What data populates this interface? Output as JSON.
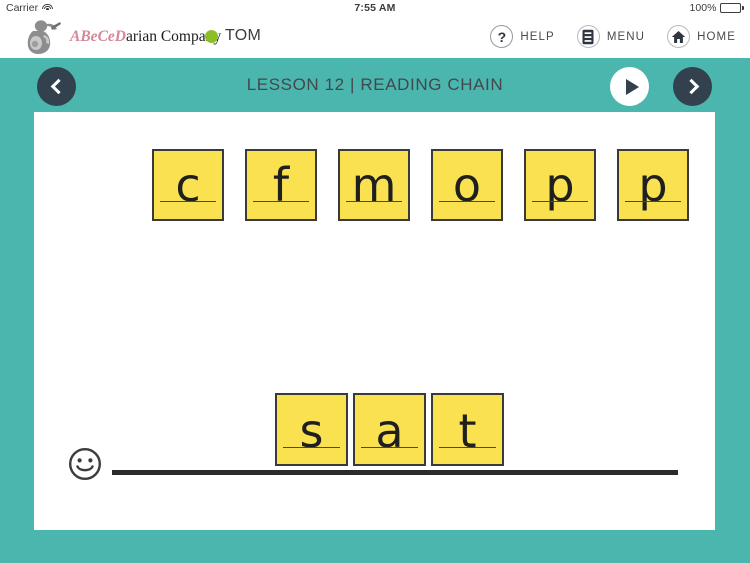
{
  "status_bar": {
    "carrier": "Carrier",
    "wifi_icon": "wifi-icon",
    "time": "7:55 AM",
    "battery_percent": "100%",
    "battery_icon": "battery-full-icon"
  },
  "header": {
    "logo_icon": "abecedarian-logo-icon",
    "brand_a": "A",
    "brand_b": "Be",
    "brand_c": "Ce",
    "brand_d": "D",
    "brand_rest": "arian Company",
    "user_status_icon": "status-dot-icon",
    "user_name": "TOM",
    "actions": [
      {
        "label": "HELP",
        "icon": "question-mark-icon"
      },
      {
        "label": "MENU",
        "icon": "menu-list-icon"
      },
      {
        "label": "HOME",
        "icon": "home-icon"
      }
    ]
  },
  "lesson": {
    "title": "LESSON 12 | READING CHAIN",
    "prev_icon": "chevron-left-icon",
    "play_icon": "play-icon",
    "next_icon": "chevron-right-icon"
  },
  "activity": {
    "top_row_tiles": [
      "c",
      "f",
      "m",
      "o",
      "p",
      "p"
    ],
    "bottom_row_tiles": [
      "s",
      "a",
      "t"
    ],
    "bottom_word": "sat",
    "smiley_icon": "smiley-face-icon",
    "writing_line": "writing-line"
  },
  "colors": {
    "teal_background": "#4bb6ae",
    "tile_yellow": "#fae14f",
    "tile_border": "#3a3a3a",
    "dark_button": "#33404d",
    "status_dot_green": "#8cbf26",
    "brand_accent_pink": "#d4889a"
  }
}
